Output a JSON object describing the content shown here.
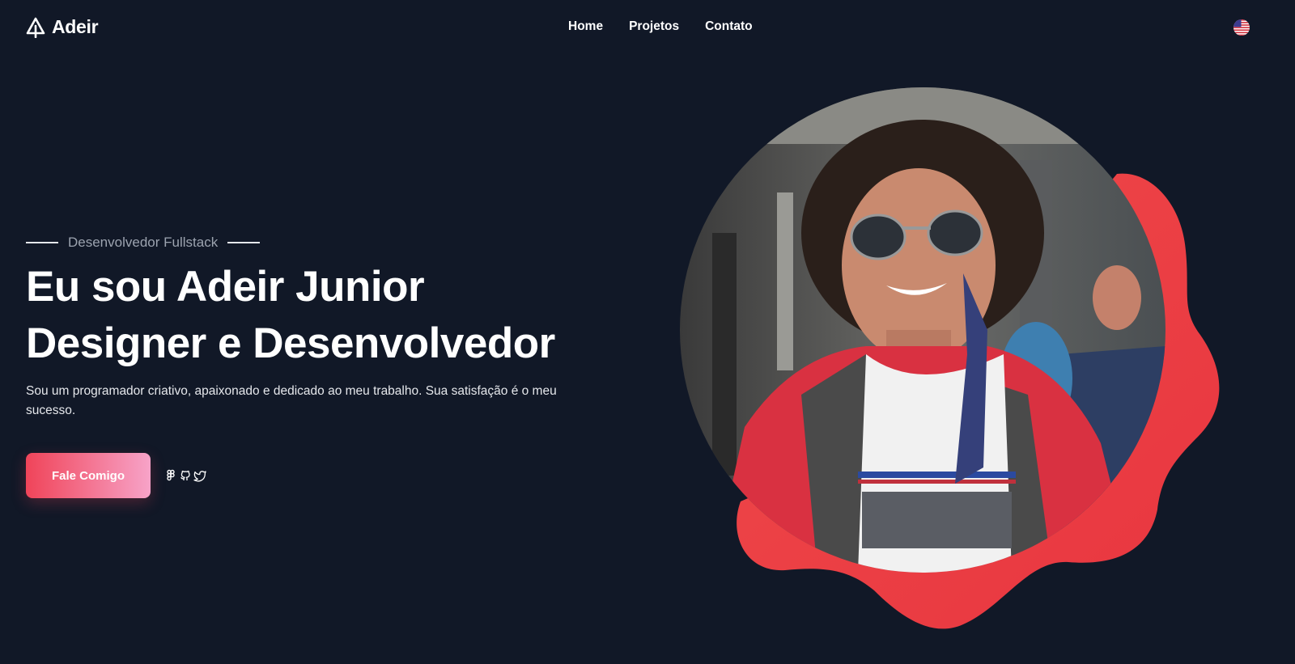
{
  "header": {
    "logo_text": "Adeir",
    "nav": [
      {
        "label": "Home"
      },
      {
        "label": "Projetos"
      },
      {
        "label": "Contato"
      }
    ],
    "language_icon": "us-flag-icon"
  },
  "hero": {
    "subtitle": "Desenvolvedor Fullstack",
    "headline_line1": "Eu sou Adeir Junior",
    "headline_line2": "Designer e Desenvolvedor",
    "description": "Sou um programador criativo, apaixonado e dedicado ao meu trabalho. Sua satisfação é o meu sucesso.",
    "cta_label": "Fale Comigo",
    "socials": [
      {
        "icon": "figma-icon"
      },
      {
        "icon": "github-icon"
      },
      {
        "icon": "twitter-icon"
      }
    ]
  },
  "theme": {
    "background": "#111827",
    "accent": "#ef4444",
    "gradient_start": "#f04459",
    "gradient_end": "#f7a3c8"
  }
}
